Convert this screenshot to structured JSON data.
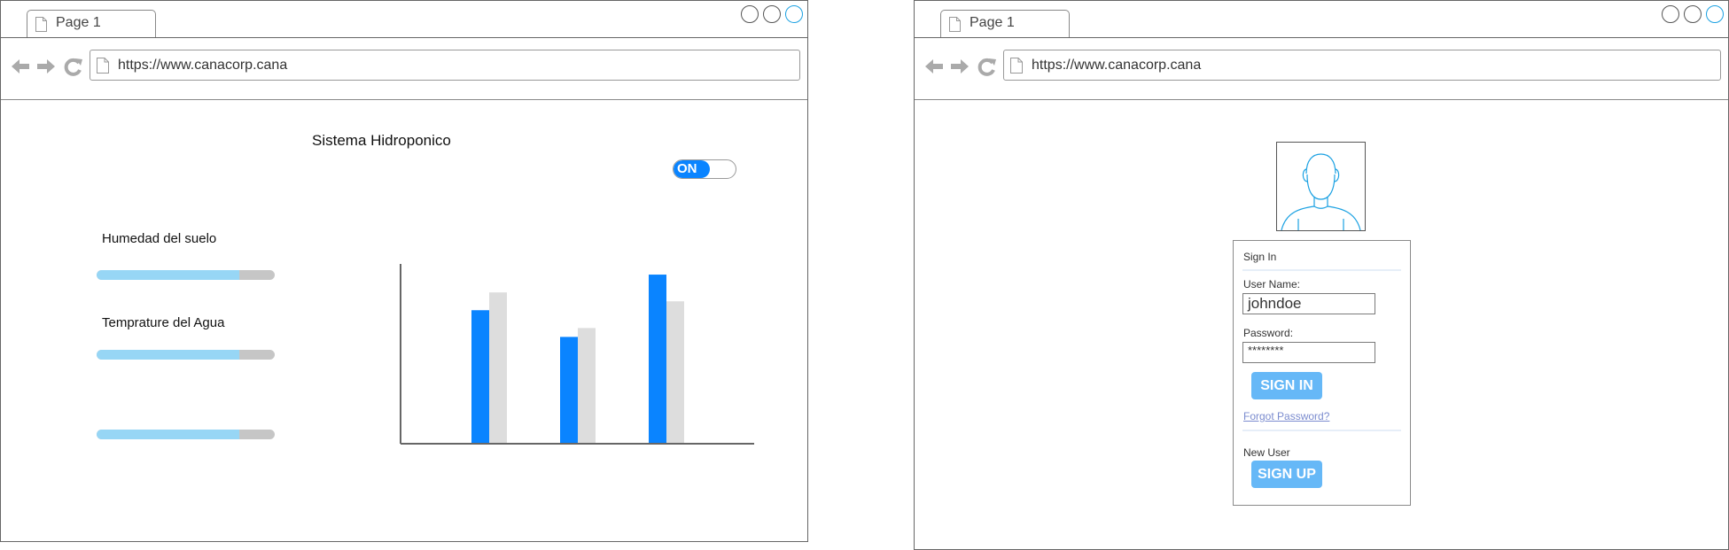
{
  "browser": {
    "tab_label": "Page 1",
    "url": "https://www.canacorp.cana"
  },
  "dashboard": {
    "title": "Sistema Hidroponico",
    "toggle_label": "ON",
    "soil_humidity_label": "Humedad del suelo",
    "water_temp_label": "Temprature del Agua",
    "progress_values": [
      0.8,
      0.8,
      0.8
    ],
    "colors": {
      "progress_fill": "#97d6f5",
      "progress_track": "#c6c6c6",
      "toggle_on": "#0a84ff"
    }
  },
  "chart_data": {
    "type": "bar",
    "categories": [
      "",
      "",
      ""
    ],
    "series": [
      {
        "values": [
          150,
          120,
          190
        ],
        "color": "#0a84ff"
      },
      {
        "values": [
          170,
          130,
          160
        ],
        "color": "#dddddd"
      }
    ],
    "ylim": [
      0,
      200
    ],
    "grid": false,
    "xlabel": "",
    "ylabel": ""
  },
  "login": {
    "heading": "Sign In",
    "username_label": "User Name:",
    "username_value": "johndoe",
    "password_label": "Password:",
    "password_value": "********",
    "signin_button": "SIGN IN",
    "forgot_link": "Forgot Password?",
    "new_user_label": "New User",
    "signup_button": "SIGN UP",
    "colors": {
      "button": "#66b8f7",
      "avatar_stroke": "#1ba1e2"
    }
  }
}
